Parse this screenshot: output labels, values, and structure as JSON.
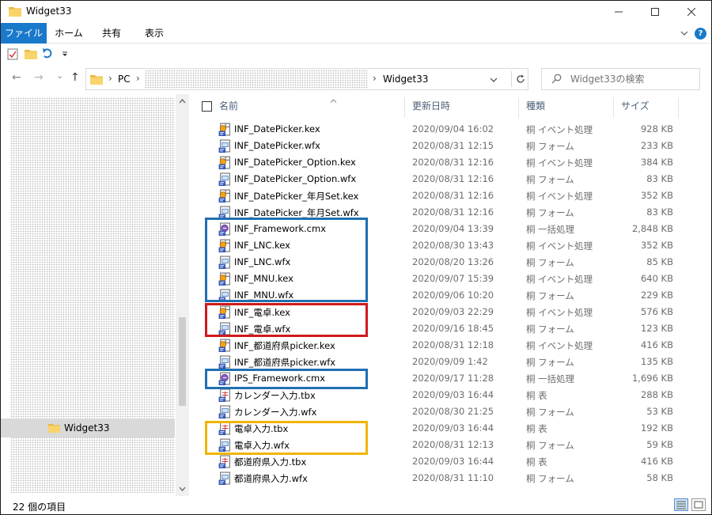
{
  "window": {
    "title": "Widget33"
  },
  "ribbon": {
    "tabs": [
      "ファイル",
      "ホーム",
      "共有",
      "表示"
    ]
  },
  "nav": {
    "back": "←",
    "forward": "→",
    "history": "⌄",
    "up": "↑",
    "address": {
      "root": "PC",
      "current": "Widget33"
    },
    "search_placeholder": "Widget33の検索"
  },
  "sidebar": {
    "selected_item": "Widget33"
  },
  "columns": {
    "name": "名前",
    "date": "更新日時",
    "type": "種類",
    "size": "サイズ"
  },
  "files": [
    {
      "name": "INF_DatePicker.kex",
      "date": "2020/09/04 16:02",
      "type": "桐 イベント処理",
      "size": "928 KB",
      "icon": "kex-icon"
    },
    {
      "name": "INF_DatePicker.wfx",
      "date": "2020/08/31 12:15",
      "type": "桐 フォーム",
      "size": "233 KB",
      "icon": "wfx-icon"
    },
    {
      "name": "INF_DatePicker_Option.kex",
      "date": "2020/08/31 12:16",
      "type": "桐 イベント処理",
      "size": "384 KB",
      "icon": "kex-icon"
    },
    {
      "name": "INF_DatePicker_Option.wfx",
      "date": "2020/08/31 12:16",
      "type": "桐 フォーム",
      "size": "83 KB",
      "icon": "wfx-icon"
    },
    {
      "name": "INF_DatePicker_年月Set.kex",
      "date": "2020/08/31 12:16",
      "type": "桐 イベント処理",
      "size": "352 KB",
      "icon": "kex-icon"
    },
    {
      "name": "INF_DatePicker_年月Set.wfx",
      "date": "2020/08/31 12:16",
      "type": "桐 フォーム",
      "size": "83 KB",
      "icon": "wfx-icon"
    },
    {
      "name": "INF_Framework.cmx",
      "date": "2020/09/04 13:39",
      "type": "桐 一括処理",
      "size": "2,848 KB",
      "icon": "cmx-icon"
    },
    {
      "name": "INF_LNC.kex",
      "date": "2020/08/30 13:43",
      "type": "桐 イベント処理",
      "size": "352 KB",
      "icon": "kex-icon"
    },
    {
      "name": "INF_LNC.wfx",
      "date": "2020/08/20 13:26",
      "type": "桐 フォーム",
      "size": "85 KB",
      "icon": "wfx-icon"
    },
    {
      "name": "INF_MNU.kex",
      "date": "2020/09/07 15:39",
      "type": "桐 イベント処理",
      "size": "640 KB",
      "icon": "kex-icon"
    },
    {
      "name": "INF_MNU.wfx",
      "date": "2020/09/06 10:20",
      "type": "桐 フォーム",
      "size": "229 KB",
      "icon": "wfx-icon"
    },
    {
      "name": "INF_電卓.kex",
      "date": "2020/09/03 22:29",
      "type": "桐 イベント処理",
      "size": "576 KB",
      "icon": "kex-icon"
    },
    {
      "name": "INF_電卓.wfx",
      "date": "2020/09/16 18:45",
      "type": "桐 フォーム",
      "size": "123 KB",
      "icon": "wfx-icon"
    },
    {
      "name": "INF_都道府県picker.kex",
      "date": "2020/08/31 12:18",
      "type": "桐 イベント処理",
      "size": "416 KB",
      "icon": "kex-icon"
    },
    {
      "name": "INF_都道府県picker.wfx",
      "date": "2020/09/09 1:42",
      "type": "桐 フォーム",
      "size": "135 KB",
      "icon": "wfx-icon"
    },
    {
      "name": "IPS_Framework.cmx",
      "date": "2020/09/17 11:28",
      "type": "桐 一括処理",
      "size": "1,696 KB",
      "icon": "cmx-icon"
    },
    {
      "name": "カレンダー入力.tbx",
      "date": "2020/09/03 16:44",
      "type": "桐 表",
      "size": "288 KB",
      "icon": "tbx-icon"
    },
    {
      "name": "カレンダー入力.wfx",
      "date": "2020/08/30 21:25",
      "type": "桐 フォーム",
      "size": "53 KB",
      "icon": "wfx-icon"
    },
    {
      "name": "電卓入力.tbx",
      "date": "2020/09/03 16:44",
      "type": "桐 表",
      "size": "192 KB",
      "icon": "tbx-icon"
    },
    {
      "name": "電卓入力.wfx",
      "date": "2020/08/31 12:13",
      "type": "桐 フォーム",
      "size": "59 KB",
      "icon": "wfx-icon"
    },
    {
      "name": "都道府県入力.tbx",
      "date": "2020/09/03 16:44",
      "type": "桐 表",
      "size": "416 KB",
      "icon": "tbx-icon"
    },
    {
      "name": "都道府県入力.wfx",
      "date": "2020/08/31 11:10",
      "type": "桐 フォーム",
      "size": "58 KB",
      "icon": "wfx-icon"
    }
  ],
  "highlights": [
    {
      "label": "framework-group",
      "color": "#1f6fb2"
    },
    {
      "label": "calculator-group",
      "color": "#d0191c"
    },
    {
      "label": "ips-framework",
      "color": "#1f6fb2"
    },
    {
      "label": "calculator-input-group",
      "color": "#f0b400"
    }
  ],
  "status": {
    "item_count": "22 個の項目"
  },
  "colors": {
    "accent": "#1979ca",
    "header_text": "#4c607a",
    "secondary_text": "#6d6d6d"
  }
}
